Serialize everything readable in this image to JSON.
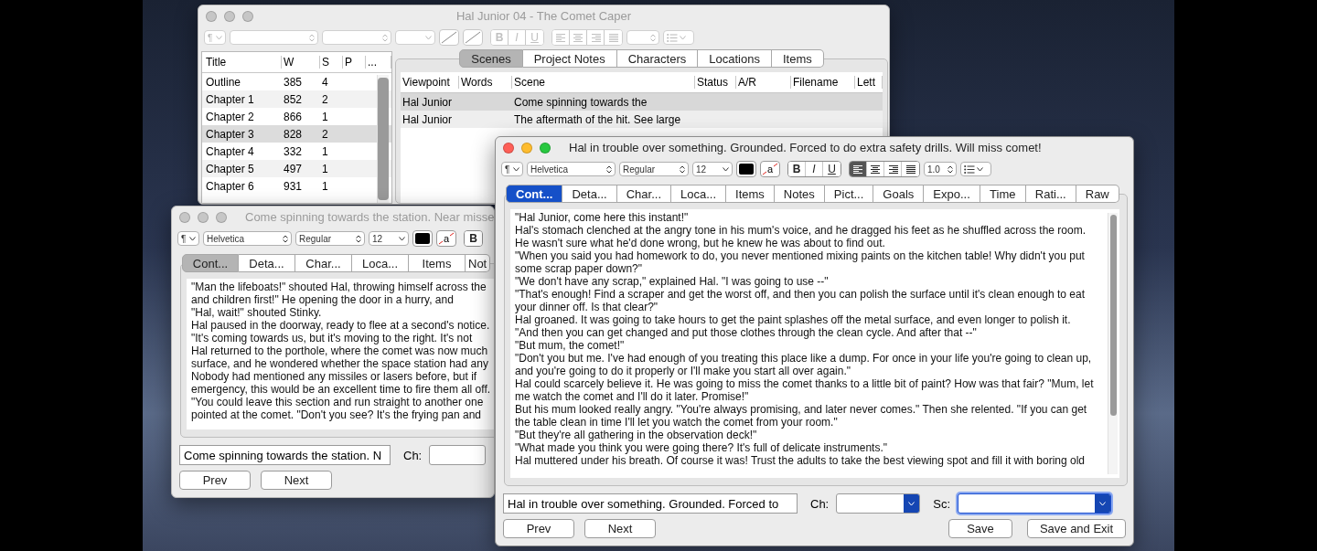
{
  "project_window": {
    "title": "Hal Junior 04 - The Comet Caper",
    "active": false,
    "toolbar": [
      {
        "kind": "para",
        "label": "¶"
      },
      {
        "kind": "font"
      },
      {
        "kind": "style"
      },
      {
        "kind": "size"
      },
      {
        "kind": "color"
      },
      {
        "kind": "highlight"
      },
      {
        "kind": "format",
        "buttons": [
          "B",
          "I",
          "U"
        ]
      },
      {
        "kind": "align",
        "options": [
          {
            "selected": false
          },
          {
            "selected": false
          },
          {
            "selected": false
          },
          {
            "selected": false
          }
        ]
      },
      {
        "kind": "spacing"
      },
      {
        "kind": "list"
      }
    ],
    "toolbar_disabled": true,
    "outline": {
      "columns": [
        "Title",
        "W",
        "S",
        "P",
        "..."
      ],
      "rows": [
        {
          "title": "Outline",
          "w": "385",
          "s": "4",
          "selected": false
        },
        {
          "title": "Chapter 1",
          "w": "852",
          "s": "2",
          "selected": false
        },
        {
          "title": "Chapter 2",
          "w": "866",
          "s": "1",
          "selected": false
        },
        {
          "title": "Chapter 3",
          "w": "828",
          "s": "2",
          "selected": true
        },
        {
          "title": "Chapter 4",
          "w": "332",
          "s": "1",
          "selected": false
        },
        {
          "title": "Chapter 5",
          "w": "497",
          "s": "1",
          "selected": false
        },
        {
          "title": "Chapter 6",
          "w": "931",
          "s": "1",
          "selected": false
        }
      ]
    },
    "tabs": [
      {
        "label": "Scenes",
        "selected": true
      },
      {
        "label": "Project Notes",
        "selected": false
      },
      {
        "label": "Characters",
        "selected": false
      },
      {
        "label": "Locations",
        "selected": false
      },
      {
        "label": "Items",
        "selected": false
      }
    ],
    "scenes": {
      "columns": [
        "Viewpoint",
        "Words",
        "Scene",
        "Status",
        "A/R",
        "Filename",
        "Lett"
      ],
      "rows": [
        {
          "viewpoint": "Hal Junior",
          "scene": "Come spinning towards the",
          "selected": true
        },
        {
          "viewpoint": "Hal Junior",
          "scene": "The aftermath of the hit. See large",
          "selected": false
        }
      ]
    }
  },
  "scene_windows": [
    {
      "title": "Come spinning towards the station. Near misse",
      "active": false,
      "toolbar": [
        {
          "kind": "para",
          "label": "¶"
        },
        {
          "kind": "font",
          "value": "Helvetica"
        },
        {
          "kind": "style",
          "value": "Regular"
        },
        {
          "kind": "size",
          "value": "12"
        },
        {
          "kind": "color",
          "color": "#000000"
        },
        {
          "kind": "highlight",
          "label": "a"
        },
        {
          "kind": "format",
          "buttons": [
            "B"
          ]
        }
      ],
      "tabs": [
        {
          "label": "Cont...",
          "selected": true
        },
        {
          "label": "Deta...",
          "selected": false
        },
        {
          "label": "Char...",
          "selected": false
        },
        {
          "label": "Loca...",
          "selected": false
        },
        {
          "label": "Items",
          "selected": false
        },
        {
          "label": "Not",
          "selected": false
        }
      ],
      "lines": [
        "\"Man the lifeboats!\" shouted Hal, throwing himself across the",
        "and children first!\" He opening the door in a hurry, and",
        "\"Hal, wait!\" shouted Stinky.",
        "Hal paused in the doorway, ready to flee at a second's notice.",
        "\"It's coming towards us, but it's moving to the right. It's not",
        "Hal returned to the porthole, where the comet was now much",
        "surface, and he wondered whether the space station had any",
        "Nobody had mentioned any missiles or lasers before, but if",
        "emergency, this would be an excellent time to fire them all off.",
        "\"You could leave this section and run straight to another one",
        "pointed at the comet. \"Don't you see? It's the frying pan and"
      ],
      "summary": "Come spinning towards the station. N",
      "fields": [
        {
          "label": "Ch:",
          "focused": false
        }
      ],
      "nav_buttons": [
        "Prev",
        "Next"
      ]
    },
    {
      "title": "Hal in trouble over something. Grounded. Forced to do extra safety drills. Will miss comet!",
      "active": true,
      "toolbar": [
        {
          "kind": "para",
          "label": "¶"
        },
        {
          "kind": "font",
          "value": "Helvetica"
        },
        {
          "kind": "style",
          "value": "Regular"
        },
        {
          "kind": "size",
          "value": "12"
        },
        {
          "kind": "color",
          "color": "#000000"
        },
        {
          "kind": "highlight",
          "label": "a"
        },
        {
          "kind": "format",
          "buttons": [
            "B",
            "I",
            "U"
          ]
        },
        {
          "kind": "align",
          "options": [
            {
              "selected": true
            },
            {
              "selected": false
            },
            {
              "selected": false
            },
            {
              "selected": false
            }
          ]
        },
        {
          "kind": "spacing",
          "value": "1.0"
        },
        {
          "kind": "list"
        }
      ],
      "tabs": [
        {
          "label": "Cont...",
          "selected": true
        },
        {
          "label": "Deta...",
          "selected": false
        },
        {
          "label": "Char...",
          "selected": false
        },
        {
          "label": "Loca...",
          "selected": false
        },
        {
          "label": "Items",
          "selected": false
        },
        {
          "label": "Notes",
          "selected": false
        },
        {
          "label": "Pict...",
          "selected": false
        },
        {
          "label": "Goals",
          "selected": false
        },
        {
          "label": "Expo...",
          "selected": false
        },
        {
          "label": "Time",
          "selected": false
        },
        {
          "label": "Rati...",
          "selected": false
        },
        {
          "label": "Raw",
          "selected": false
        }
      ],
      "paragraphs": [
        "\"Hal Junior, come here this instant!\"",
        "Hal's stomach clenched at the angry tone in his mum's voice, and he dragged his feet as he shuffled across the room. He wasn't sure what he'd done wrong, but he knew he was about to find out.",
        "\"When you said you had homework to do, you never mentioned mixing paints on the kitchen table! Why didn't you put some scrap paper down?\"",
        "\"We don't have any scrap,\" explained Hal. \"I was going to use --\"",
        "\"That's enough! Find a scraper and get the worst off, and then you can polish the surface until it's clean enough to eat your dinner off. Is that clear?\"",
        "Hal groaned. It was going to take hours to get the paint splashes off the metal surface, and even longer to polish it.",
        "\"And then you can get changed and put those clothes through the clean cycle. And after that --\"",
        "\"But mum, the comet!\"",
        "\"Don't you but me. I've had enough of you treating this place like a dump. For once in your life you're going to clean up, and you're going to do it properly or I'll make you start all over again.\"",
        "Hal could scarcely believe it. He was going to miss the comet thanks to a little bit of paint? How was that fair? \"Mum, let me watch the comet and I'll do it later. Promise!\"",
        "But his mum looked really angry. \"You're always promising, and later never comes.\" Then she relented. \"If you can get the table clean in time I'll let you watch the comet from your room.\"",
        "\"But they're all gathering in the observation deck!\"",
        "\"What made you think you were going there? It's full of delicate instruments.\"",
        "Hal muttered under his breath. Of course it was! Trust the adults to take the best viewing spot and fill it with boring old"
      ],
      "summary": "Hal in trouble over something. Grounded. Forced to",
      "fields": [
        {
          "label": "Ch:",
          "focused": false
        },
        {
          "label": "Sc:",
          "focused": true
        }
      ],
      "nav_buttons": [
        "Prev",
        "Next"
      ],
      "action_buttons": [
        "Save",
        "Save and Exit"
      ]
    }
  ]
}
